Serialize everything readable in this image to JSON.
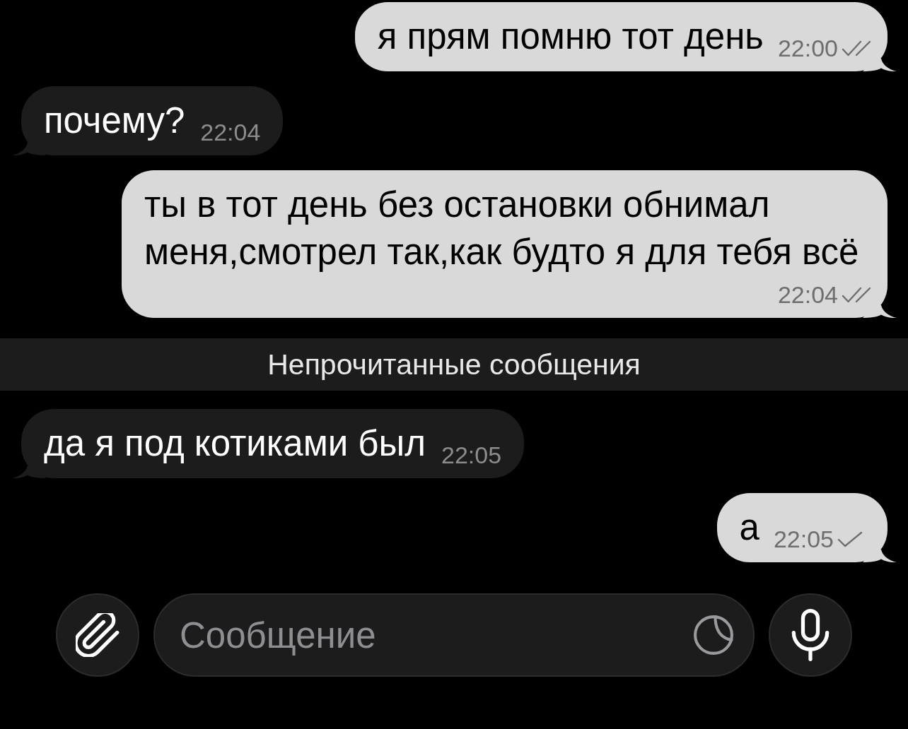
{
  "messages": [
    {
      "kind": "outgoing",
      "text": "я прям помню тот день",
      "time": "22:00",
      "read": true
    },
    {
      "kind": "incoming",
      "text": "почему?",
      "time": "22:04"
    },
    {
      "kind": "outgoing",
      "text": "ты в тот день без остановки обнимал меня,смотрел так,как будто я для тебя всё",
      "time": "22:04",
      "read": true
    },
    {
      "kind": "unread_divider",
      "text": "Непрочитанные сообщения"
    },
    {
      "kind": "incoming",
      "text": "да я под котиками был",
      "time": "22:05"
    },
    {
      "kind": "outgoing",
      "text": "а",
      "time": "22:05",
      "read": false
    }
  ],
  "composer": {
    "placeholder": "Сообщение"
  }
}
